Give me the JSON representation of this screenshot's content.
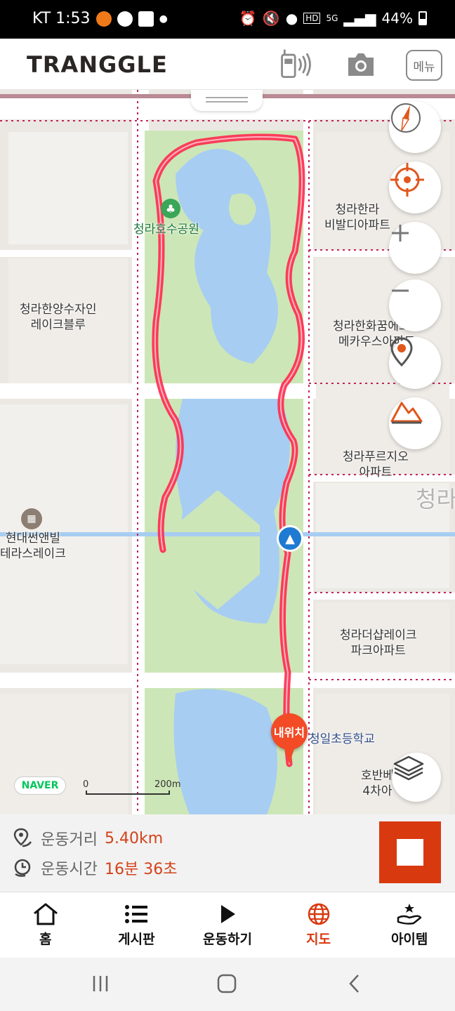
{
  "status_bar": {
    "carrier_time": "KT 1:53",
    "battery": "44%",
    "network": "5G"
  },
  "header": {
    "logo": "TRANGGLE",
    "menu_label": "메뉴",
    "icons": [
      "walkie-talkie-icon",
      "camera-icon"
    ]
  },
  "map": {
    "labels": {
      "park": "청라호수공원",
      "apt_hanra": "청라한라\n비발디아파트",
      "apt_yangsu": "청라한양수자인\n레이크블루",
      "apt_hwa": "청라한화꿈에그린\n메카우스아파트",
      "apt_prugio": "청라푸르지오\n아파트",
      "apt_hyundai": "현대썬앤빌\n테라스레이크",
      "apt_the_sharp": "청라더샵레이크\n파크아파트",
      "school": "청일초등학교",
      "hoban": "호반베\n4차아",
      "area_big": "청라",
      "my_location": "내위치"
    },
    "attribution": "NAVER",
    "scale": {
      "start": "0",
      "end": "200m"
    },
    "controls": [
      "compass-icon",
      "target-icon",
      "zoom-in",
      "zoom-out",
      "location-pin-icon",
      "terrain-icon",
      "layers-icon"
    ],
    "route_color": "#ff2a4d"
  },
  "stats": {
    "distance_label": "운동거리",
    "distance_value": "5.40km",
    "time_label": "운동시간",
    "time_value": "16분 36초",
    "accent": "#d9390f"
  },
  "bottom_nav": {
    "items": [
      {
        "label": "홈",
        "icon": "home-icon"
      },
      {
        "label": "게시판",
        "icon": "list-icon"
      },
      {
        "label": "운동하기",
        "icon": "play-icon"
      },
      {
        "label": "지도",
        "icon": "globe-icon",
        "active": true
      },
      {
        "label": "아이템",
        "icon": "item-hand-icon"
      }
    ]
  }
}
